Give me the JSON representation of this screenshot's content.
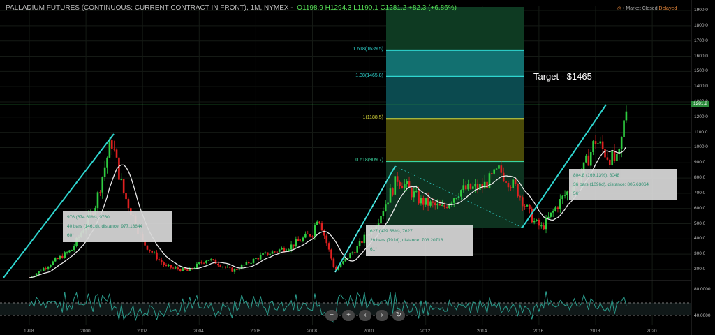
{
  "header": {
    "title": "PALLADIUM FUTURES (CONTINUOUS: CURRENT CONTRACT IN FRONT), 1M, NYMEX",
    "open": "O1198.9",
    "high": "H1294.3",
    "low": "L1190.1",
    "close": "C1281.2",
    "change": "+82.3 (+6.86%)"
  },
  "status": {
    "market": "Market Closed",
    "feed": "Delayed"
  },
  "y_axis": [
    "1900.0",
    "1800.0",
    "1700.0",
    "1600.0",
    "1500.0",
    "1400.0",
    "1300.0",
    "1200.0",
    "1100.0",
    "1000.0",
    "900.0",
    "800.0",
    "700.0",
    "600.0",
    "500.0",
    "400.0",
    "300.0",
    "200.0"
  ],
  "last_price": "1281.2",
  "x_axis": [
    "1998",
    "2000",
    "2002",
    "2004",
    "2006",
    "2008",
    "2010",
    "2012",
    "2014",
    "2016",
    "2018",
    "2020"
  ],
  "oscillator_axis": [
    "80.0000",
    "40.0000"
  ],
  "fib_levels": [
    {
      "label": "1.618(1639.5)",
      "price": 1639.5,
      "color": "#2fd6d0"
    },
    {
      "label": "1.38(1465.8)",
      "price": 1465.8,
      "color": "#2fd6d0"
    },
    {
      "label": "1(1188.5)",
      "price": 1188.5,
      "color": "#d8d83a"
    },
    {
      "label": "0.618(909.7)",
      "price": 909.7,
      "color": "#3ad6a0"
    }
  ],
  "annotation": "Target - $1465",
  "info_boxes": [
    {
      "line1": "976 (674.61%), 9760",
      "line2": "40 bars (1461d), distance: 977.18844",
      "line3": "60°"
    },
    {
      "line1": "627 (429.58%), 7627",
      "line2": "26 bars (791d), distance: 703.20718",
      "line3": "61°"
    },
    {
      "line1": "804.8 (169.13%), 8048",
      "line2": "36 bars (1096d), distance: 805.63064",
      "line3": "56°"
    }
  ],
  "nav": [
    "−",
    "+",
    "‹",
    "›",
    "↻"
  ],
  "price_path": [
    [
      1998.0,
      145
    ],
    [
      1999.5,
      330
    ],
    [
      2000.3,
      600
    ],
    [
      2000.9,
      1050
    ],
    [
      2001.3,
      720
    ],
    [
      2002.0,
      380
    ],
    [
      2002.8,
      220
    ],
    [
      2003.6,
      190
    ],
    [
      2004.3,
      270
    ],
    [
      2005.2,
      190
    ],
    [
      2006.2,
      290
    ],
    [
      2007.2,
      350
    ],
    [
      2008.0,
      440
    ],
    [
      2008.2,
      560
    ],
    [
      2008.8,
      190
    ],
    [
      2009.6,
      350
    ],
    [
      2010.3,
      520
    ],
    [
      2011.0,
      800
    ],
    [
      2011.8,
      650
    ],
    [
      2012.6,
      600
    ],
    [
      2013.2,
      720
    ],
    [
      2014.0,
      740
    ],
    [
      2014.6,
      850
    ],
    [
      2015.2,
      730
    ],
    [
      2015.8,
      520
    ],
    [
      2016.1,
      470
    ],
    [
      2016.8,
      660
    ],
    [
      2017.5,
      820
    ],
    [
      2018.0,
      1050
    ],
    [
      2018.4,
      950
    ],
    [
      2018.8,
      900
    ],
    [
      2019.1,
      1281
    ]
  ]
}
